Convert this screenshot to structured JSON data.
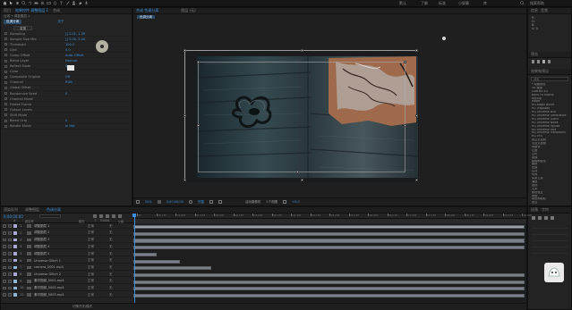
{
  "menubar": {
    "left_label": "文件 编辑 合成 图层 效果 动画 视图 窗口 帮助",
    "workspaces": [
      "默认",
      "了解",
      "标准",
      "小屏幕",
      "库"
    ],
    "right_label": "搜索帮助"
  },
  "effect_panel": {
    "tabs": [
      "项目",
      "效果控件 调整图层 1",
      "合成"
    ],
    "layer_path": "合成 • 调整图层 1",
    "effect_name": "色调分离",
    "effect_link": "关于",
    "reset_label": "重置",
    "rows": [
      {
        "label": "Sampling",
        "value": "[] 2.01, 1.39"
      },
      {
        "label": "Sample Size Mid",
        "value": "[] 2.00, 2.00"
      },
      {
        "label": "Threshold",
        "value": "100.0"
      },
      {
        "label": "Grid",
        "value": "0.0"
      },
      {
        "label": "Comp Offset",
        "value": "Auto-Offset"
      },
      {
        "label": "Blend Layer",
        "value": "Normal"
      },
      {
        "label": "Reflect Mode",
        "value": "0"
      },
      {
        "label": "Color",
        "value": ""
      },
      {
        "label": "Composite Original",
        "value": "Off"
      },
      {
        "label": "Channel",
        "value": "RGB"
      },
      {
        "label": "Global Offset",
        "value": ""
      },
      {
        "label": "Randomize Seed",
        "value": "0"
      },
      {
        "label": "Channel Mode",
        "value": ""
      },
      {
        "label": "Freeze Frame",
        "value": ""
      },
      {
        "label": "Output Levels",
        "value": ""
      },
      {
        "label": "Shift Mode",
        "value": ""
      },
      {
        "label": "Blend Orig",
        "value": "0"
      },
      {
        "label": "Render Mode",
        "value": "In Hdr"
      }
    ]
  },
  "viewer": {
    "tabs": [
      "合成 色调分离",
      "图层 (无)"
    ],
    "sub_tab": "色调分离",
    "footer": {
      "zoom": "50%",
      "timecode": "0;00;00;00",
      "quality": "完整",
      "camera": "活动摄像机",
      "views": "1个视图",
      "exposure": "+0.0"
    }
  },
  "right_panel": {
    "top_tabs": [
      "信息",
      "音频"
    ],
    "info_lines": [
      "R:",
      "G:",
      "B:",
      "A: 0"
    ],
    "preview_tab": "预览",
    "effects_tab": "效果和预设",
    "search_placeholder": "搜索",
    "items": [
      "* 动画预设",
      "3D 通道",
      "CINEMA 4D",
      "Boris FX Mocha",
      "Keying",
      "Matte",
      "RG Magic Bullet",
      "RG Trapcode",
      "RG Universe Blur",
      "RG Universe Generators",
      "RG Universe Glitch",
      "RG Universe Noise",
      "RG Universe Stylize",
      "RG Universe Text",
      "RG Universe Transitions",
      "RG VFX",
      "表达式控制",
      "沉浸式视频",
      "风格化",
      "过渡",
      "过时",
      "抠像",
      "模糊和锐化",
      "模拟",
      "扭曲",
      "生成",
      "时间",
      "实用工具",
      "通道",
      "透视",
      "文本",
      "颜色校正",
      "音频",
      "杂色和颗粒",
      "遮罩"
    ],
    "bottom_tab": "段落",
    "bottom_tab2": "字符"
  },
  "timeline": {
    "tabs": [
      "渲染队列",
      "调整图层",
      "色调分离"
    ],
    "timecode": "0;00;00;00",
    "headers": [
      "#",
      "源名称",
      "模式",
      "T",
      "TrkMat",
      "父级"
    ],
    "ruler": [
      "0f",
      "00:15f",
      "01:00f",
      "01:15f",
      "02:00f",
      "02:15f",
      "03:00f",
      "03:15f",
      "04:00f",
      "04:15f",
      "05:00f",
      "05:15f",
      "06:00f",
      "06:15f",
      "07:00f",
      "07:15f",
      "08:00f",
      "08:15f",
      "09:00f",
      "09:15f",
      "10:00f"
    ],
    "layers": [
      {
        "num": "1",
        "name": "调整图层 1",
        "mode": "正常",
        "parent": "无",
        "bar_end": 1.0,
        "bar_start": 0.0,
        "color": "#a9a9d4"
      },
      {
        "num": "2",
        "name": "调整图层 2",
        "mode": "正常",
        "parent": "无",
        "bar_end": 1.0,
        "bar_start": 0.0,
        "color": "#a9a9d4"
      },
      {
        "num": "3",
        "name": "调整图层 3",
        "mode": "正常",
        "parent": "无",
        "bar_end": 1.0,
        "bar_start": 0.0,
        "color": "#a9a9d4"
      },
      {
        "num": "4",
        "name": "调整图层 4",
        "mode": "正常",
        "parent": "无",
        "bar_end": 1.0,
        "bar_start": 0.0,
        "color": "#a9a9d4"
      },
      {
        "num": "5",
        "name": "调整图层 5",
        "mode": "正常",
        "parent": "无",
        "bar_end": 0.06,
        "bar_start": 0.0,
        "color": "#a9a9d4"
      },
      {
        "num": "6",
        "name": "Universe Glitch 1",
        "mode": "正常",
        "parent": "无",
        "bar_end": 0.12,
        "bar_start": 0.0,
        "color": "#a9a9d4"
      },
      {
        "num": "7",
        "name": "camera_0001.mp4",
        "mode": "正常",
        "parent": "无",
        "bar_end": 0.2,
        "bar_start": 0.0,
        "color": "#8fb5d0"
      },
      {
        "num": "8",
        "name": "Universe Glitch 2",
        "mode": "正常",
        "parent": "无",
        "bar_end": 1.0,
        "bar_start": 0.0,
        "color": "#a9a9d4"
      },
      {
        "num": "9",
        "name": "素材视频_0001.mp4",
        "mode": "正常",
        "parent": "无",
        "bar_end": 1.0,
        "bar_start": 0.0,
        "color": "#8fb5d0"
      },
      {
        "num": "10",
        "name": "素材视频_0002.mp4",
        "mode": "正常",
        "parent": "无",
        "bar_end": 1.0,
        "bar_start": 0.0,
        "color": "#8fb5d0"
      },
      {
        "num": "11",
        "name": "素材视频_0003.mp4",
        "mode": "正常",
        "parent": "无",
        "bar_end": 1.0,
        "bar_start": 0.0,
        "color": "#8fb5d0"
      }
    ],
    "footer": "切换开关/模式"
  }
}
